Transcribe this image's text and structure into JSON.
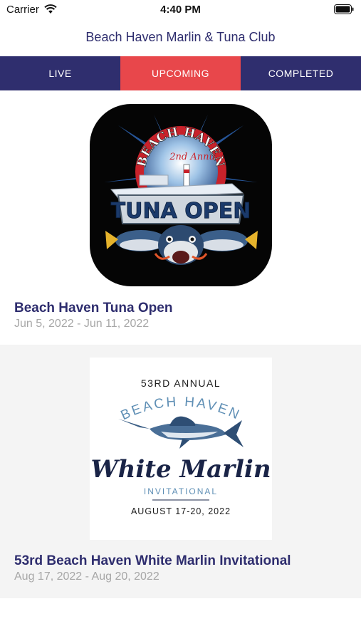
{
  "status_bar": {
    "carrier": "Carrier",
    "time": "4:40 PM"
  },
  "header": {
    "title": "Beach Haven Marlin & Tuna Club"
  },
  "tabs": [
    {
      "label": "LIVE",
      "active": false
    },
    {
      "label": "UPCOMING",
      "active": true
    },
    {
      "label": "COMPLETED",
      "active": false
    }
  ],
  "events": [
    {
      "name": "Beach Haven Tuna Open",
      "dates": "Jun 5, 2022 - Jun 11, 2022",
      "logo": {
        "top_text": "BEACH HAVEN",
        "edition": "2nd Annual",
        "main_text": "TUNA OPEN"
      }
    },
    {
      "name": "53rd Beach Haven White Marlin Invitational",
      "dates": "Aug 17, 2022 - Aug 20, 2022",
      "logo": {
        "edition": "53RD ANNUAL",
        "arc_text": "BEACH HAVEN",
        "main_text": "White Marlin",
        "sub_text": "INVITATIONAL",
        "date_text": "AUGUST 17-20, 2022"
      }
    }
  ],
  "colors": {
    "brand_navy": "#2f2e6e",
    "accent_red": "#e8474b",
    "date_gray": "#a7a7a7"
  }
}
